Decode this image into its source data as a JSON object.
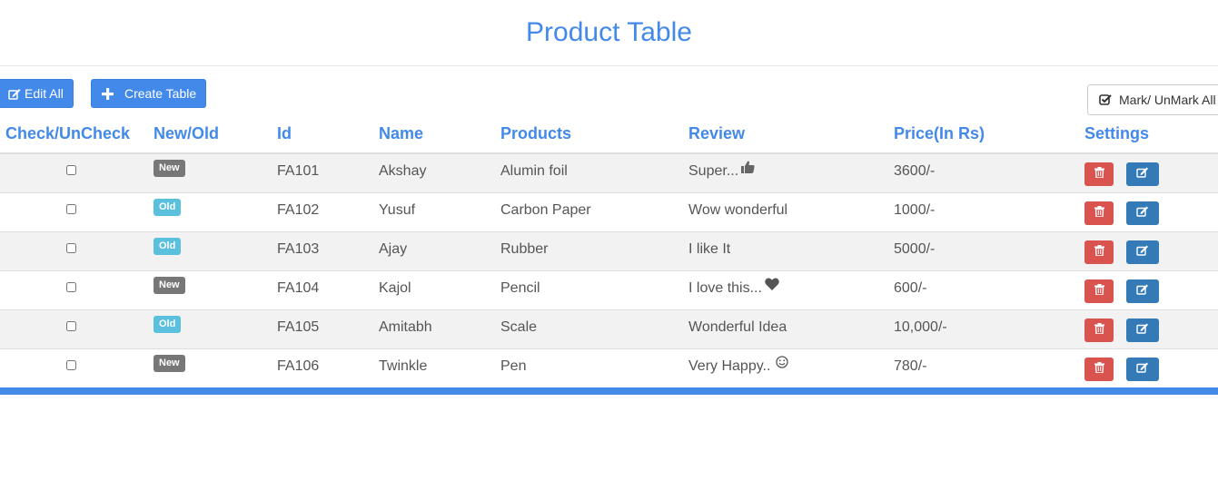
{
  "page": {
    "title": "Product Table"
  },
  "toolbar": {
    "edit_all_label": "Edit All",
    "create_table_label": "Create Table",
    "mark_unmark_label": "Mark/ UnMark All"
  },
  "table": {
    "headers": [
      "Check/UnCheck",
      "New/Old",
      "Id",
      "Name",
      "Products",
      "Review",
      "Price(In Rs)",
      "Settings"
    ],
    "rows": [
      {
        "checked": false,
        "status": "New",
        "id": "FA101",
        "name": "Akshay",
        "product": "Alumin foil",
        "review": "Super...",
        "review_icon": "thumbs-up-icon",
        "price": "3600/-"
      },
      {
        "checked": false,
        "status": "Old",
        "id": "FA102",
        "name": "Yusuf",
        "product": "Carbon Paper",
        "review": "Wow wonderful",
        "review_icon": "",
        "price": "1000/-"
      },
      {
        "checked": false,
        "status": "Old",
        "id": "FA103",
        "name": "Ajay",
        "product": "Rubber",
        "review": "I like It",
        "review_icon": "",
        "price": "5000/-"
      },
      {
        "checked": false,
        "status": "New",
        "id": "FA104",
        "name": "Kajol",
        "product": "Pencil",
        "review": "I love this...",
        "review_icon": "heart-icon",
        "price": "600/-"
      },
      {
        "checked": false,
        "status": "Old",
        "id": "FA105",
        "name": "Amitabh",
        "product": "Scale",
        "review": "Wonderful Idea",
        "review_icon": "",
        "price": "10,000/-"
      },
      {
        "checked": false,
        "status": "New",
        "id": "FA106",
        "name": "Twinkle",
        "product": "Pen",
        "review": "Very Happy..",
        "review_icon": "smile-icon",
        "price": "780/-"
      }
    ]
  },
  "colors": {
    "accent": "#4289ea",
    "badge_new": "#777777",
    "badge_old": "#5bc0de",
    "delete": "#d9534f",
    "edit": "#337ab7",
    "stripe": "#f1f2f1"
  }
}
